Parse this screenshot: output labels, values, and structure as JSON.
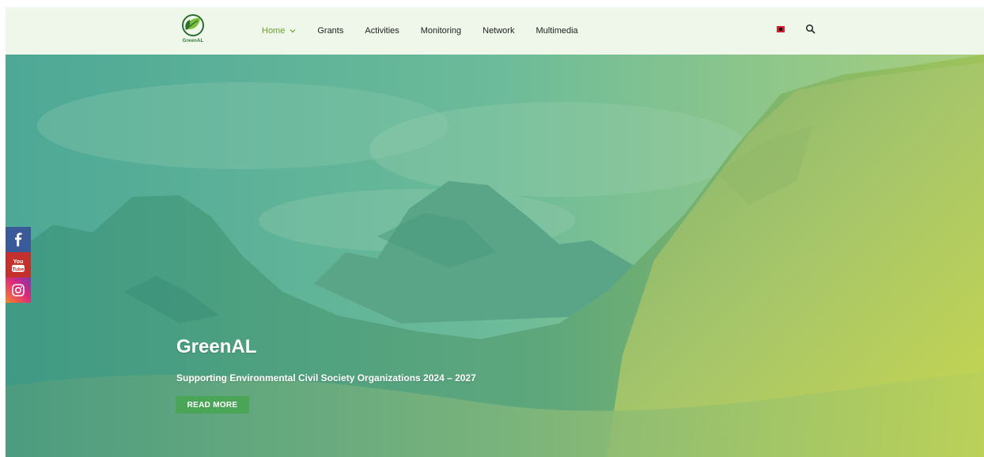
{
  "brand": {
    "logo_text": "GreenAL"
  },
  "nav": {
    "items": [
      {
        "label": "Home",
        "active": true,
        "has_dropdown": true
      },
      {
        "label": "Grants"
      },
      {
        "label": "Activities"
      },
      {
        "label": "Monitoring"
      },
      {
        "label": "Network"
      },
      {
        "label": "Multimedia"
      }
    ]
  },
  "icons": {
    "flag": "albania-flag-icon",
    "search": "search-icon",
    "social": [
      "facebook-icon",
      "youtube-icon",
      "instagram-icon"
    ]
  },
  "hero": {
    "title": "GreenAL",
    "subtitle": "Supporting Environmental Civil Society Organizations 2024 – 2027",
    "button_label": "READ MORE"
  },
  "colors": {
    "header_bg": "#eef7ea",
    "accent": "#6aa12b",
    "button": "#4aa556",
    "facebook": "#3b5a9a",
    "youtube": "#c4302b"
  }
}
